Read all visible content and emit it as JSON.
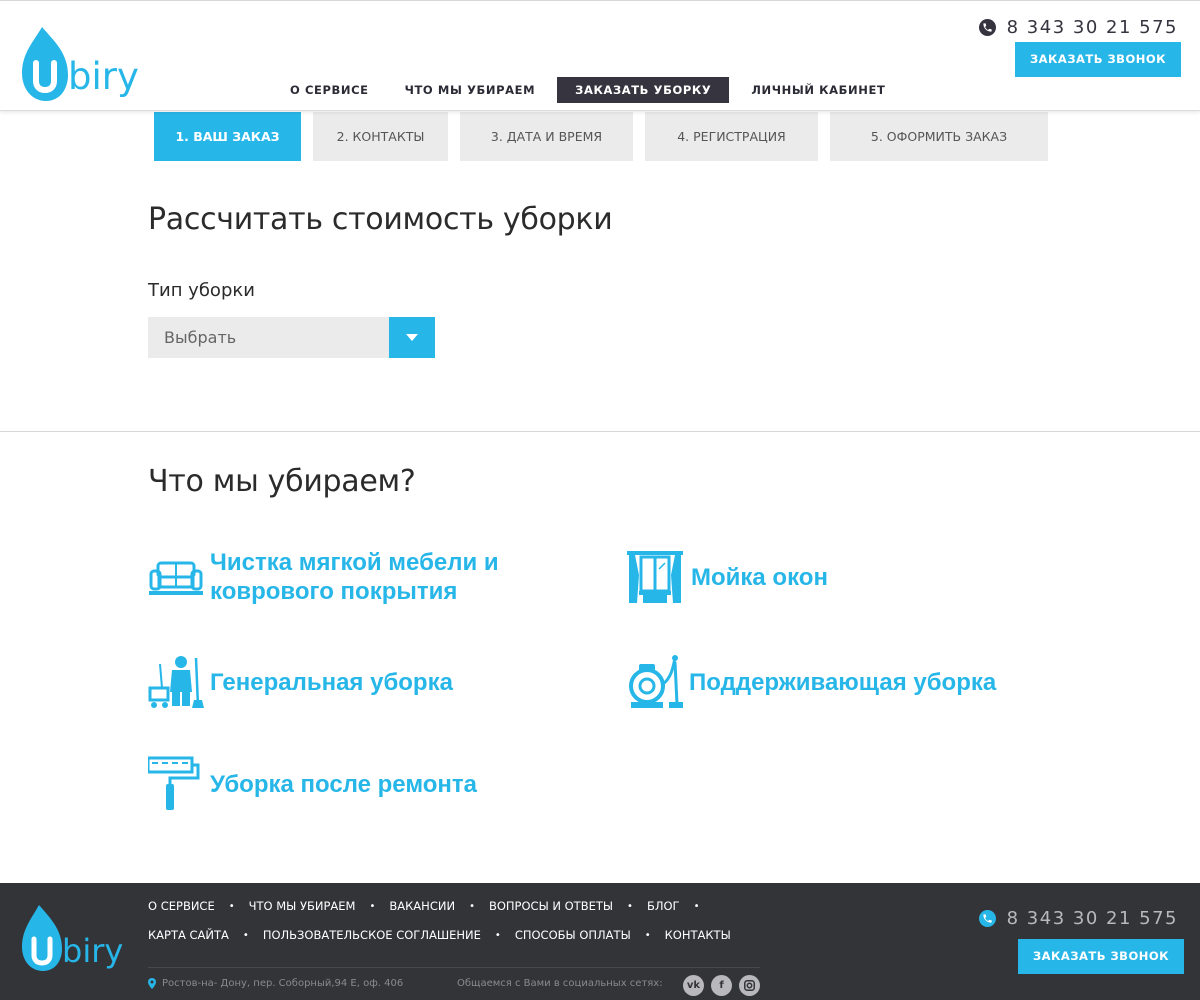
{
  "header": {
    "logo_text": "biry",
    "nav": [
      "О СЕРВИСЕ",
      "ЧТО МЫ УБИРАЕМ",
      "ЗАКАЗАТЬ УБОРКУ",
      "ЛИЧНЫЙ КАБИНЕТ"
    ],
    "active_nav": "ЗАКАЗАТЬ УБОРКУ",
    "phone": "8 343 30 21 575",
    "call_button": "ЗАКАЗАТЬ ЗВОНОК"
  },
  "steps": [
    "1. ВАШ ЗАКАЗ",
    "2. КОНТАКТЫ",
    "3. ДАТА И ВРЕМЯ",
    "4. РЕГИСТРАЦИЯ",
    "5. ОФОРМИТЬ ЗАКАЗ"
  ],
  "active_step": "1. ВАШ ЗАКАЗ",
  "calculator": {
    "title": "Рассчитать стоимость уборки",
    "type_label": "Тип уборки",
    "select_value": "Выбрать"
  },
  "services": {
    "title": "Что мы убираем?",
    "items": [
      {
        "line1": "Чистка мягкой мебели и",
        "line2": "коврового покрытия",
        "icon": "sofa-icon"
      },
      {
        "line1": "Мойка окон",
        "line2": "",
        "icon": "window-icon"
      },
      {
        "line1": "Генеральная уборка",
        "line2": "",
        "icon": "cleaner-icon"
      },
      {
        "line1": "Поддерживающая уборка",
        "line2": "",
        "icon": "vacuum-icon"
      },
      {
        "line1": "Уборка после ремонта",
        "line2": "",
        "icon": "paint-roller-icon"
      }
    ]
  },
  "footer": {
    "logo_text": "biry",
    "links_row1": [
      "О СЕРВИСЕ",
      "ЧТО МЫ УБИРАЕМ",
      "ВАКАНСИИ",
      "ВОПРОСЫ И ОТВЕТЫ",
      "БЛОГ"
    ],
    "links_row2": [
      "КАРТА САЙТА",
      "ПОЛЬЗОВАТЕЛЬСКОЕ СОГЛАШЕНИЕ",
      "СПОСОБЫ ОПЛАТЫ",
      "КОНТАКТЫ"
    ],
    "address": "Ростов-на- Дону, пер. Соборный,94 Е, оф. 406",
    "social_label": "Общаемся с Вами в социальных сетях:",
    "social": [
      "vk",
      "f",
      "ig"
    ],
    "phone": "8 343 30 21 575",
    "call_button": "ЗАКАЗАТЬ ЗВОНОК"
  },
  "colors": {
    "accent": "#27b6e8",
    "dark": "#35343f",
    "footer_bg": "#333438"
  }
}
